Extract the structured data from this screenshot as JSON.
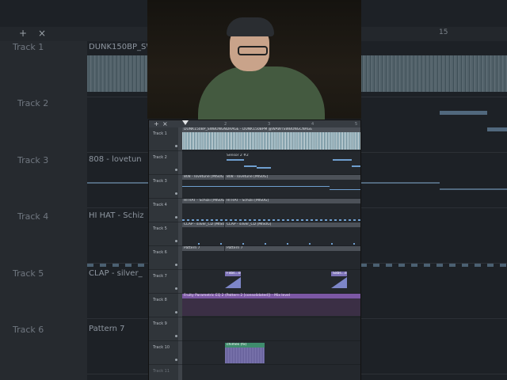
{
  "background": {
    "tracks": [
      "Track 1",
      "Track 2",
      "Track 3",
      "Track 4",
      "Track 5",
      "Track 6"
    ],
    "clips": [
      "DUNK150BP_SW",
      "808 - lovetun",
      "HI HAT - Schiz",
      "CLAP - silver_",
      "Pattern 7"
    ],
    "ruler_number": "15"
  },
  "toolbar": {
    "add_label": "+",
    "close_label": "×",
    "ruler_ticks": [
      "2",
      "3",
      "4",
      "5"
    ]
  },
  "tracks": [
    {
      "name": "Track 1",
      "clip": "DUNK150BP_SWBONGNDRAGE - DUNK150BPM @WAWTSWBONGCNAGE"
    },
    {
      "name": "Track 2",
      "clip": "Sensor 2 #2"
    },
    {
      "name": "Track 3",
      "clip_a": "808 - lovetune [MIS0G]",
      "clip_b": "808 - lovetune [MIS0G]"
    },
    {
      "name": "Track 4",
      "clip_a": "HI HAT - Schizii [MIS0G]",
      "clip_b": "HI HAT - Schizii [MIS0G]"
    },
    {
      "name": "Track 5",
      "clip_a": "CLAP - silver_CD [MIS0G]",
      "clip_b": "CLAP - silver_CD [MIS0G]"
    },
    {
      "name": "Track 6",
      "clip_a": "Pattern 7",
      "clip_b": "Pattern 7"
    },
    {
      "name": "Track 7",
      "clip_a": "Fxbs...ss",
      "clip_b": "Sxbs...ss"
    },
    {
      "name": "Track 8",
      "clip": "Fruity Parametric EQ 2 (Pattern 2 [consolidated]) - Mix level"
    },
    {
      "name": "Track 9"
    },
    {
      "name": "Track 10",
      "clip": "chimes (fx)"
    },
    {
      "name": "Track 11"
    }
  ],
  "colors": {
    "automation": "#7c58a5",
    "notes": "#6f9fcf",
    "audio_clip": "#3f8c6d"
  }
}
